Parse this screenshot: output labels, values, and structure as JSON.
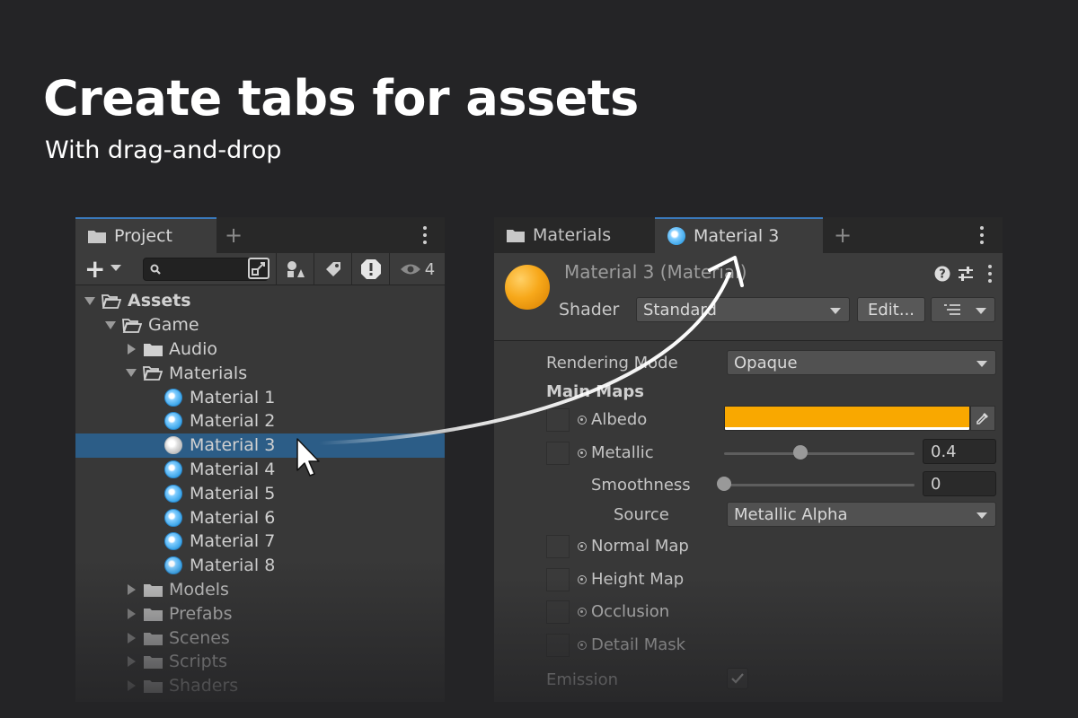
{
  "hero": {
    "title": "Create tabs for assets",
    "subtitle": "With drag-and-drop"
  },
  "project": {
    "tab_label": "Project",
    "toolbar": {
      "search_placeholder": "",
      "hidden_count": "4"
    },
    "tree": [
      {
        "label": "Assets",
        "depth": 0,
        "kind": "folder-open",
        "expanded": true,
        "bold": true
      },
      {
        "label": "Game",
        "depth": 1,
        "kind": "folder-open",
        "expanded": true
      },
      {
        "label": "Audio",
        "depth": 2,
        "kind": "folder",
        "expanded": false
      },
      {
        "label": "Materials",
        "depth": 2,
        "kind": "folder-open",
        "expanded": true
      },
      {
        "label": "Material 1",
        "depth": 3,
        "kind": "material"
      },
      {
        "label": "Material 2",
        "depth": 3,
        "kind": "material"
      },
      {
        "label": "Material 3",
        "depth": 3,
        "kind": "material",
        "selected": true
      },
      {
        "label": "Material 4",
        "depth": 3,
        "kind": "material"
      },
      {
        "label": "Material 5",
        "depth": 3,
        "kind": "material"
      },
      {
        "label": "Material 6",
        "depth": 3,
        "kind": "material"
      },
      {
        "label": "Material 7",
        "depth": 3,
        "kind": "material"
      },
      {
        "label": "Material 8",
        "depth": 3,
        "kind": "material"
      },
      {
        "label": "Models",
        "depth": 2,
        "kind": "folder",
        "expanded": false
      },
      {
        "label": "Prefabs",
        "depth": 2,
        "kind": "folder",
        "expanded": false
      },
      {
        "label": "Scenes",
        "depth": 2,
        "kind": "folder",
        "expanded": false
      },
      {
        "label": "Scripts",
        "depth": 2,
        "kind": "folder",
        "expanded": false
      },
      {
        "label": "Shaders",
        "depth": 2,
        "kind": "folder",
        "expanded": false
      }
    ]
  },
  "inspector": {
    "tabs": [
      {
        "label": "Materials",
        "icon": "folder-icon",
        "active": false
      },
      {
        "label": "Material 3",
        "icon": "material-icon",
        "active": true
      }
    ],
    "title": "Material 3 (Material)",
    "shader_label": "Shader",
    "shader_value": "Standard",
    "edit_button": "Edit...",
    "rendering_mode_label": "Rendering Mode",
    "rendering_mode_value": "Opaque",
    "main_maps_label": "Main Maps",
    "albedo_label": "Albedo",
    "albedo_color": "#F9A800",
    "metallic_label": "Metallic",
    "metallic_value": "0.4",
    "metallic_level": 0.4,
    "smoothness_label": "Smoothness",
    "smoothness_value": "0",
    "smoothness_level": 0,
    "source_label": "Source",
    "source_value": "Metallic Alpha",
    "normal_map_label": "Normal Map",
    "height_map_label": "Height Map",
    "occlusion_label": "Occlusion",
    "detail_mask_label": "Detail Mask",
    "emission_label": "Emission",
    "emission_enabled": true
  },
  "colors": {
    "selection": "#2C5D87",
    "tab_accent": "#3A79BB",
    "material_icon": "#3EA7EA"
  }
}
